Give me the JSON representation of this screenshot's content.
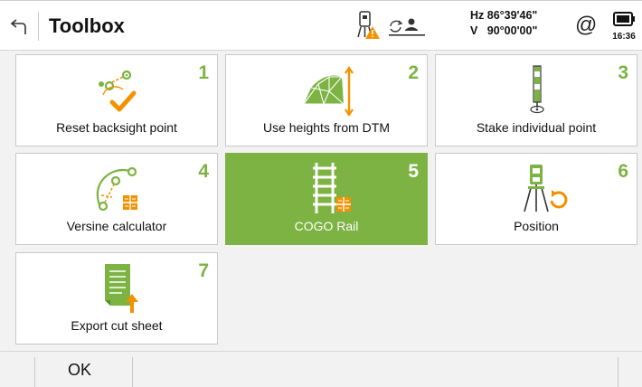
{
  "header": {
    "title": "Toolbox",
    "hz": "Hz 86°39'46\"",
    "v": "V   90°00'00\"",
    "at_symbol": "@",
    "time": "16:36",
    "icons": [
      "back-arrow-icon",
      "instrument-warning-icon",
      "prism-target-icon",
      "at-icon",
      "battery-icon"
    ]
  },
  "tiles": [
    {
      "number": "1",
      "label": "Reset backsight point",
      "icon": "backsight-icon"
    },
    {
      "number": "2",
      "label": "Use heights from DTM",
      "icon": "dtm-icon"
    },
    {
      "number": "3",
      "label": "Stake individual point",
      "icon": "stake-pole-icon"
    },
    {
      "number": "4",
      "label": "Versine calculator",
      "icon": "versine-icon"
    },
    {
      "number": "5",
      "label": "COGO Rail",
      "icon": "rail-icon",
      "selected": true
    },
    {
      "number": "6",
      "label": "Position",
      "icon": "position-icon"
    },
    {
      "number": "7",
      "label": "Export cut sheet",
      "icon": "export-sheet-icon"
    }
  ],
  "footer": {
    "ok_label": "OK"
  },
  "colors": {
    "accent_green": "#7cb342",
    "accent_orange": "#f39200",
    "text": "#111111",
    "background": "#f2f2f2"
  }
}
